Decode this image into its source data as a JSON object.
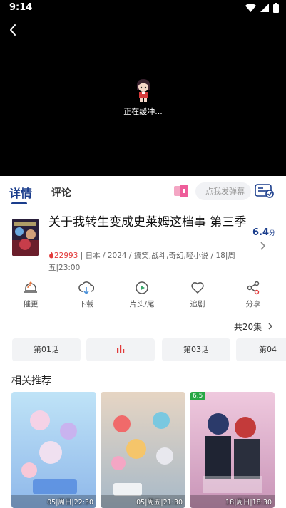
{
  "status_bar": {
    "time": "9:14"
  },
  "player": {
    "buffering_text": "正在缓冲..."
  },
  "tabs": [
    {
      "label": "详情",
      "active": true
    },
    {
      "label": "评论",
      "active": false
    }
  ],
  "danmu": {
    "placeholder": "点我发弹幕"
  },
  "anime": {
    "title": "关于我转生变成史莱姆这档事 第三季",
    "score": "6.4",
    "score_unit": "分",
    "hot_count": "22993",
    "meta_rest": " | 日本 / 2024 / 搞笑,战斗,奇幻,轻小说 / 18|周五|23:00"
  },
  "actions": [
    {
      "label": "催更",
      "icon": "bell-icon"
    },
    {
      "label": "下载",
      "icon": "cloud-download-icon"
    },
    {
      "label": "片头/尾",
      "icon": "play-circle-icon"
    },
    {
      "label": "追剧",
      "icon": "heart-icon"
    },
    {
      "label": "分享",
      "icon": "share-icon"
    }
  ],
  "episodes": {
    "total_label": "共20集",
    "items": [
      {
        "label": "第01话",
        "playing": false
      },
      {
        "label": "",
        "playing": true
      },
      {
        "label": "第03话",
        "playing": false
      },
      {
        "label": "第04",
        "playing": false
      }
    ]
  },
  "recommend": {
    "title": "相关推荐",
    "items": [
      {
        "label": "05|周日|22:30",
        "score": ""
      },
      {
        "label": "05|周五|21:30",
        "score": ""
      },
      {
        "label": "18|周日|18:30",
        "score": "6.5"
      }
    ]
  },
  "colors": {
    "accent": "#1a3d8c",
    "hot": "#e23a3a",
    "score_badge": "#28a745"
  }
}
